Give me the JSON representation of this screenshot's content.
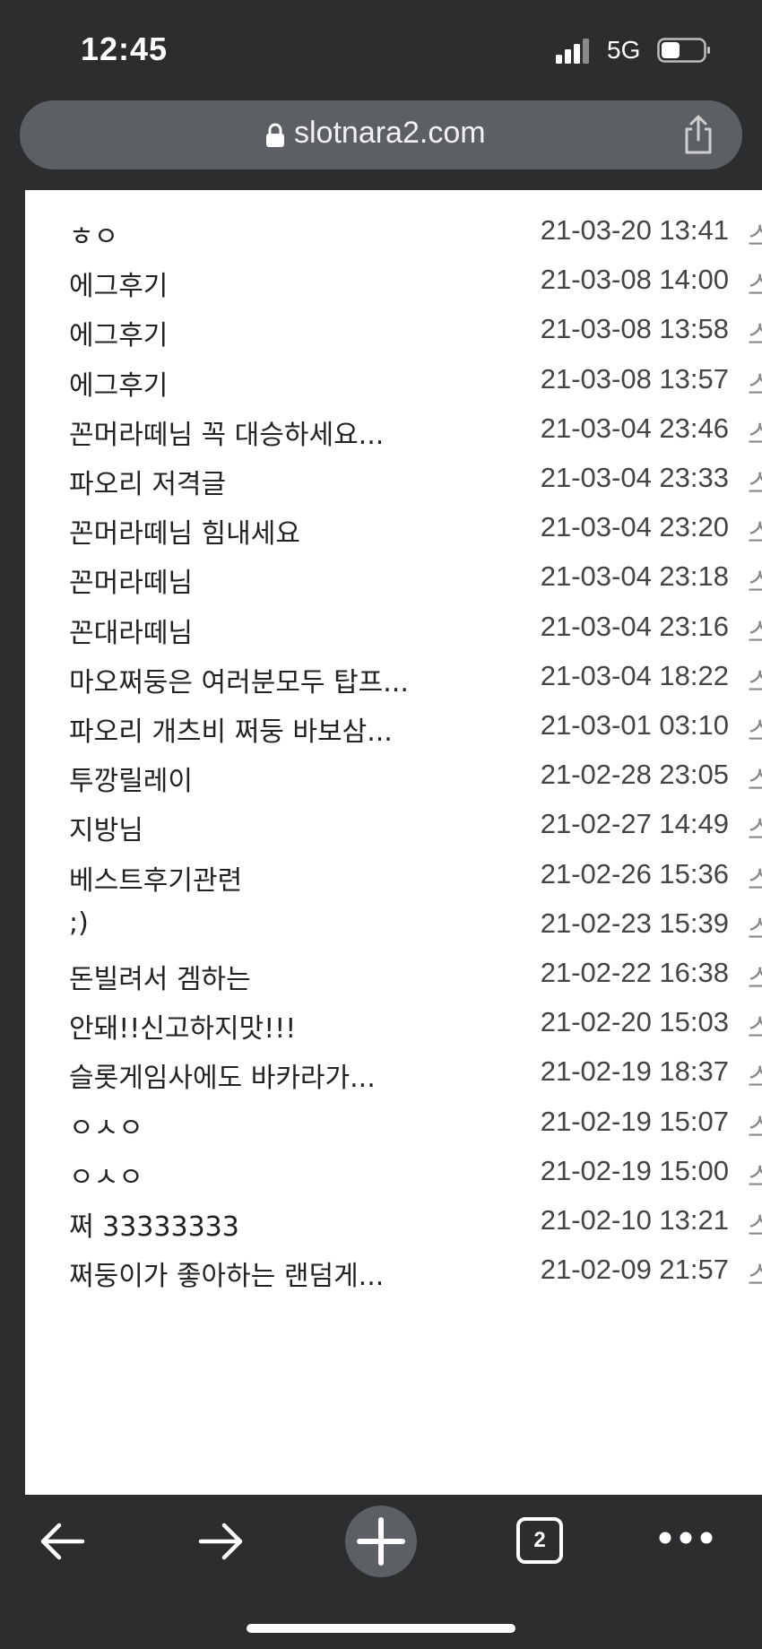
{
  "status_bar": {
    "time": "12:45",
    "network": "5G",
    "icons": [
      "signal-icon",
      "battery-icon"
    ]
  },
  "browser": {
    "url": "slotnara2.com",
    "icons": [
      "lock-icon",
      "share-icon"
    ]
  },
  "posts": [
    {
      "title": "ㅎㅇ",
      "date": "21-03-20 13:41",
      "extra": "스"
    },
    {
      "title": "에그후기",
      "date": "21-03-08 14:00",
      "extra": "스"
    },
    {
      "title": "에그후기",
      "date": "21-03-08 13:58",
      "extra": "스"
    },
    {
      "title": "에그후기",
      "date": "21-03-08 13:57",
      "extra": "스"
    },
    {
      "title": "꼰머라떼님 꼭 대승하세요...",
      "date": "21-03-04 23:46",
      "extra": "스"
    },
    {
      "title": "파오리 저격글",
      "date": "21-03-04 23:33",
      "extra": "스"
    },
    {
      "title": "꼰머라떼님 힘내세요",
      "date": "21-03-04 23:20",
      "extra": "스"
    },
    {
      "title": "꼰머라떼님",
      "date": "21-03-04 23:18",
      "extra": "스"
    },
    {
      "title": "꼰대라떼님",
      "date": "21-03-04 23:16",
      "extra": "스"
    },
    {
      "title": "마오쩌둥은 여러분모두 탑프...",
      "date": "21-03-04 18:22",
      "extra": "스"
    },
    {
      "title": "파오리 개츠비 쩌둥 바보삼...",
      "date": "21-03-01 03:10",
      "extra": "스"
    },
    {
      "title": "투깡릴레이",
      "date": "21-02-28 23:05",
      "extra": "스"
    },
    {
      "title": "지방님",
      "date": "21-02-27 14:49",
      "extra": "스"
    },
    {
      "title": "베스트후기관련",
      "date": "21-02-26 15:36",
      "extra": "스"
    },
    {
      "title": ";)",
      "date": "21-02-23 15:39",
      "extra": "스"
    },
    {
      "title": "돈빌려서 겜하는",
      "date": "21-02-22 16:38",
      "extra": "스"
    },
    {
      "title": "안돼!!신고하지맛!!!",
      "date": "21-02-20 15:03",
      "extra": "스"
    },
    {
      "title": "슬롯게임사에도 바카라가...",
      "date": "21-02-19 18:37",
      "extra": "스"
    },
    {
      "title": "ㅇㅅㅇ",
      "date": "21-02-19 15:07",
      "extra": "스"
    },
    {
      "title": "ㅇㅅㅇ",
      "date": "21-02-19 15:00",
      "extra": "스"
    },
    {
      "title": "쩌 33333333",
      "date": "21-02-10 13:21",
      "extra": "스"
    },
    {
      "title": "쩌둥이가 좋아하는 랜덤게...",
      "date": "21-02-09 21:57",
      "extra": "스"
    }
  ],
  "toolbar": {
    "tabs_count": "2",
    "icons": [
      "back-arrow-icon",
      "forward-arrow-icon",
      "plus-icon",
      "tabs-icon",
      "more-icon"
    ]
  }
}
